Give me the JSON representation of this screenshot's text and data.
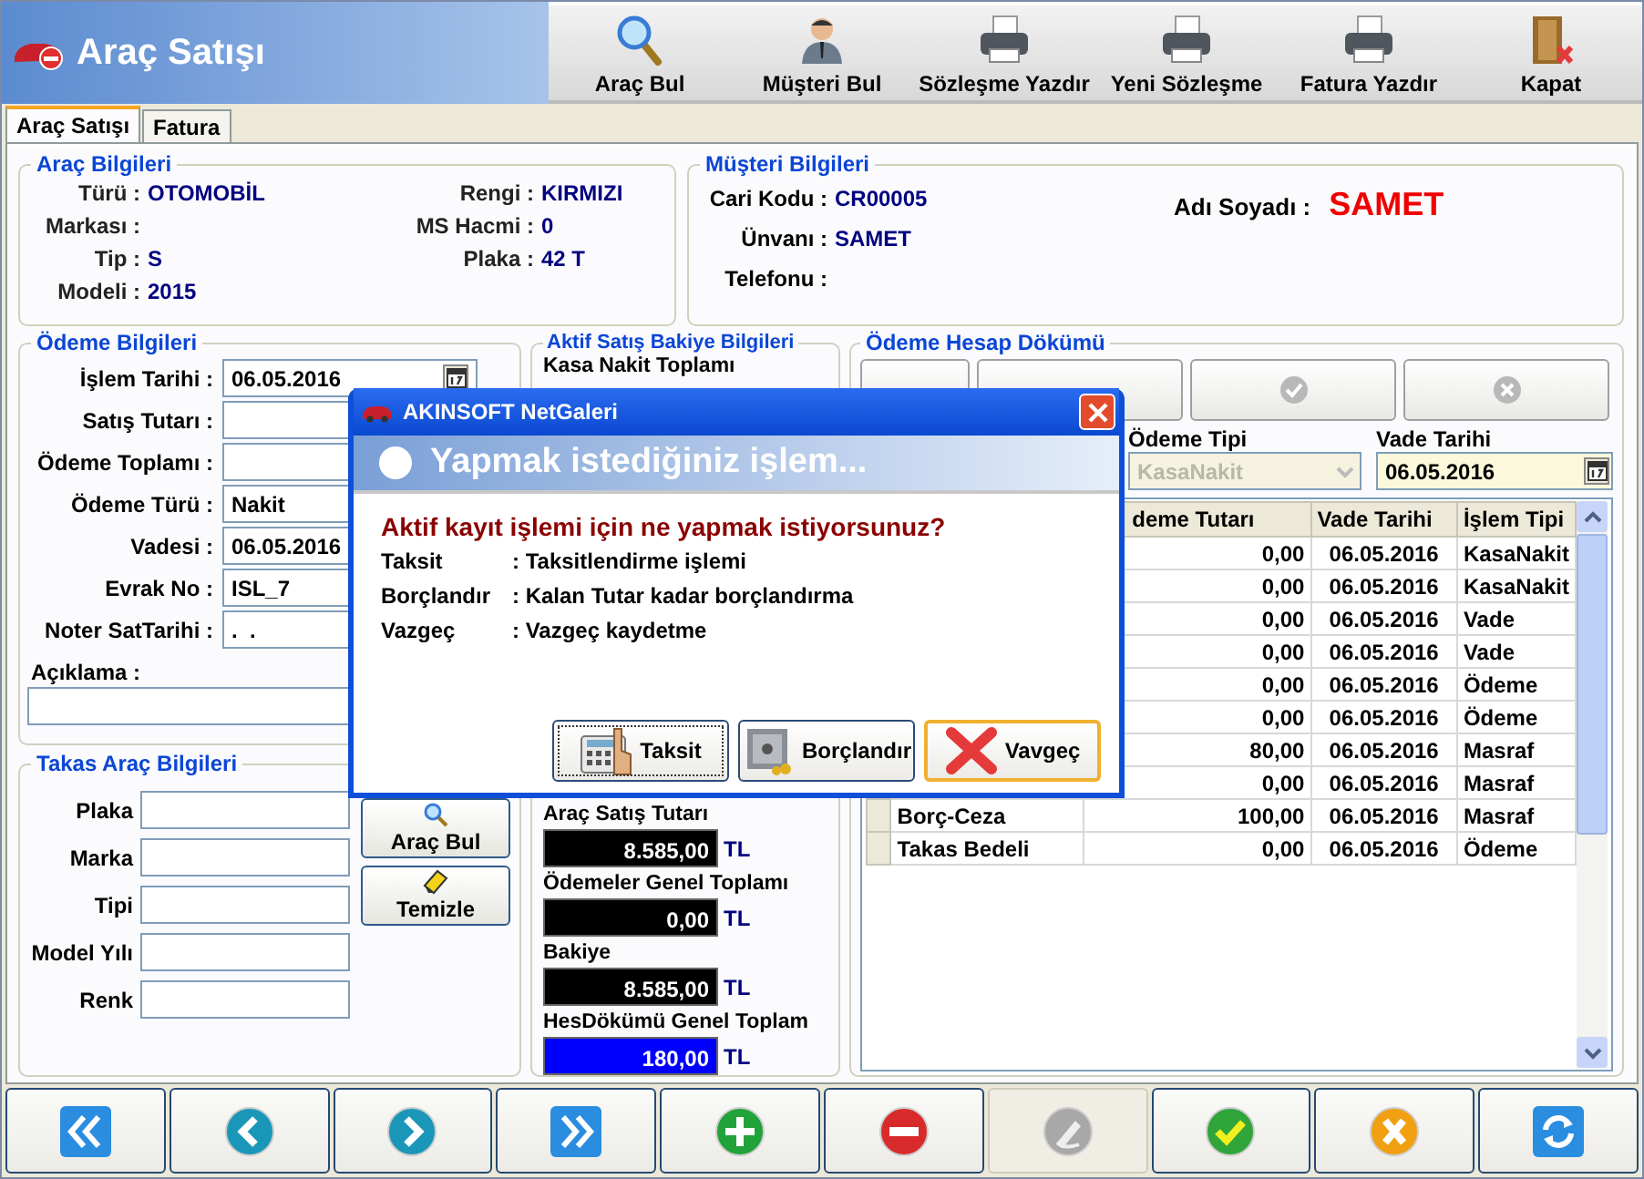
{
  "app_title": "Araç Satışı",
  "toolbar": [
    {
      "label": "Araç Bul",
      "kind": "search"
    },
    {
      "label": "Müşteri Bul",
      "kind": "person"
    },
    {
      "label": "Sözleşme Yazdır",
      "kind": "printer"
    },
    {
      "label": "Yeni Sözleşme",
      "kind": "printer"
    },
    {
      "label": "Fatura Yazdır",
      "kind": "printer"
    },
    {
      "label": "Kapat",
      "kind": "door"
    }
  ],
  "tabs": [
    {
      "label": "Araç Satışı",
      "selected": true
    },
    {
      "label": "Fatura",
      "selected": false
    }
  ],
  "vehicle": {
    "title": "Araç Bilgileri",
    "left": [
      {
        "label": "Türü :",
        "value": "OTOMOBİL"
      },
      {
        "label": "Markası :"
      },
      {
        "label": "Tip :",
        "value": "S"
      },
      {
        "label": "Modeli :",
        "value": "2015"
      }
    ],
    "right": [
      {
        "label": "Rengi :",
        "value": "KIRMIZI"
      },
      {
        "label": "MS Hacmi :",
        "value": "0"
      },
      {
        "label": "Plaka :",
        "value": "42 T"
      }
    ]
  },
  "customer": {
    "title": "Müşteri Bilgileri",
    "fields": [
      {
        "label": "Cari Kodu :",
        "value": "CR00005"
      },
      {
        "label": "Ünvanı :",
        "value": "SAMET"
      },
      {
        "label": "Telefonu :"
      }
    ],
    "name_label": "Adı Soyadı :",
    "name": "SAMET"
  },
  "payment": {
    "title": "Ödeme Bilgileri",
    "fields": [
      {
        "label": "İşlem Tarihi :",
        "value": "06.05.2016",
        "kind": "date"
      },
      {
        "label": "Satış Tutarı :",
        "kind": "text"
      },
      {
        "label": "Ödeme Toplamı :",
        "kind": "text"
      },
      {
        "label": "Ödeme Türü :",
        "value": "Nakit",
        "kind": "text"
      },
      {
        "label": "Vadesi :",
        "value": "06.05.2016",
        "kind": "text"
      },
      {
        "label": "Evrak No :",
        "value": "ISL_7",
        "kind": "text"
      },
      {
        "label": "Noter SatTarihi :",
        "value": ".  .",
        "kind": "text"
      }
    ],
    "note_label": "Açıklama :"
  },
  "trade_in": {
    "title": "Takas Araç Bilgileri",
    "fields": [
      "Plaka",
      "Marka",
      "Tipi",
      "Model Yılı",
      "Renk"
    ],
    "buttons": [
      {
        "label": "Araç Bul",
        "kind": "search"
      },
      {
        "label": "Temizle",
        "kind": "eraser"
      }
    ]
  },
  "balance": {
    "title": "Aktif Satış Bakiye Bilgileri",
    "top_label": "Kasa Nakit Toplamı",
    "totals": [
      {
        "label": "Araç Satış Tutarı",
        "value": "8.585,00",
        "unit": "TL",
        "color": "#000000"
      },
      {
        "label": "Ödemeler Genel Toplamı",
        "value": "0,00",
        "unit": "TL",
        "color": "#000000"
      },
      {
        "label": "Bakiye",
        "value": "8.585,00",
        "unit": "TL",
        "color": "#000000"
      },
      {
        "label": "HesDökümü Genel Toplam",
        "value": "180,00",
        "unit": "TL",
        "color": "#0000ff"
      }
    ]
  },
  "statement": {
    "title": "Ödeme Hesap Dökümü",
    "tool_buttons": [
      {
        "kind": "plain"
      },
      {
        "kind": "plain"
      },
      {
        "kind": "confirm"
      },
      {
        "kind": "cancel"
      }
    ],
    "type_label": "Ödeme Tipi",
    "type_value": "KasaNakit",
    "due_label": "Vade Tarihi",
    "due_value": "06.05.2016",
    "columns": [
      "deme Tutarı",
      "Vade Tarihi",
      "İşlem Tipi"
    ],
    "rows": [
      {
        "amount": "0,00",
        "date": "06.05.2016",
        "type": "KasaNakit"
      },
      {
        "amount": "0,00",
        "date": "06.05.2016",
        "type": "KasaNakit"
      },
      {
        "amount": "0,00",
        "date": "06.05.2016",
        "type": "Vade"
      },
      {
        "amount": "0,00",
        "date": "06.05.2016",
        "type": "Vade"
      },
      {
        "amount": "0,00",
        "date": "06.05.2016",
        "type": "Ödeme"
      },
      {
        "amount": "0,00",
        "date": "06.05.2016",
        "type": "Ödeme"
      },
      {
        "amount": "80,00",
        "date": "06.05.2016",
        "type": "Masraf"
      },
      {
        "amount": "0,00",
        "date": "06.05.2016",
        "type": "Masraf"
      },
      {
        "name": "Borç-Ceza",
        "amount": "100,00",
        "date": "06.05.2016",
        "type": "Masraf"
      },
      {
        "name": "Takas Bedeli",
        "amount": "0,00",
        "date": "06.05.2016",
        "type": "Ödeme"
      }
    ]
  },
  "nav_buttons": [
    {
      "kind": "first",
      "disabled": false
    },
    {
      "kind": "prev",
      "disabled": false
    },
    {
      "kind": "next",
      "disabled": false
    },
    {
      "kind": "last",
      "disabled": false
    },
    {
      "kind": "add",
      "disabled": false
    },
    {
      "kind": "delete",
      "disabled": false
    },
    {
      "kind": "edit",
      "disabled": true
    },
    {
      "kind": "save",
      "disabled": false
    },
    {
      "kind": "cancel",
      "disabled": false
    },
    {
      "kind": "refresh",
      "disabled": false
    }
  ],
  "dialog": {
    "title": "AKINSOFT NetGaleri",
    "header": "Yapmak istediğiniz işlem...",
    "question": "Aktif kayıt işlemi için ne yapmak istiyorsunuz?",
    "options": [
      {
        "name": "Taksit",
        "description": ": Taksitlendirme işlemi"
      },
      {
        "name": "Borçlandır",
        "description": ": Kalan Tutar kadar borçlandırma"
      },
      {
        "name": "Vazgeç",
        "description": ": Vazgeç kaydetme"
      }
    ],
    "buttons": [
      {
        "label": "Taksit",
        "kind": "calculator",
        "focused": true,
        "selected": false
      },
      {
        "label": "Borçlandır",
        "kind": "safe",
        "focused": false,
        "selected": false
      },
      {
        "label": "Vavgeç",
        "kind": "cancel",
        "focused": false,
        "selected": true
      }
    ]
  }
}
